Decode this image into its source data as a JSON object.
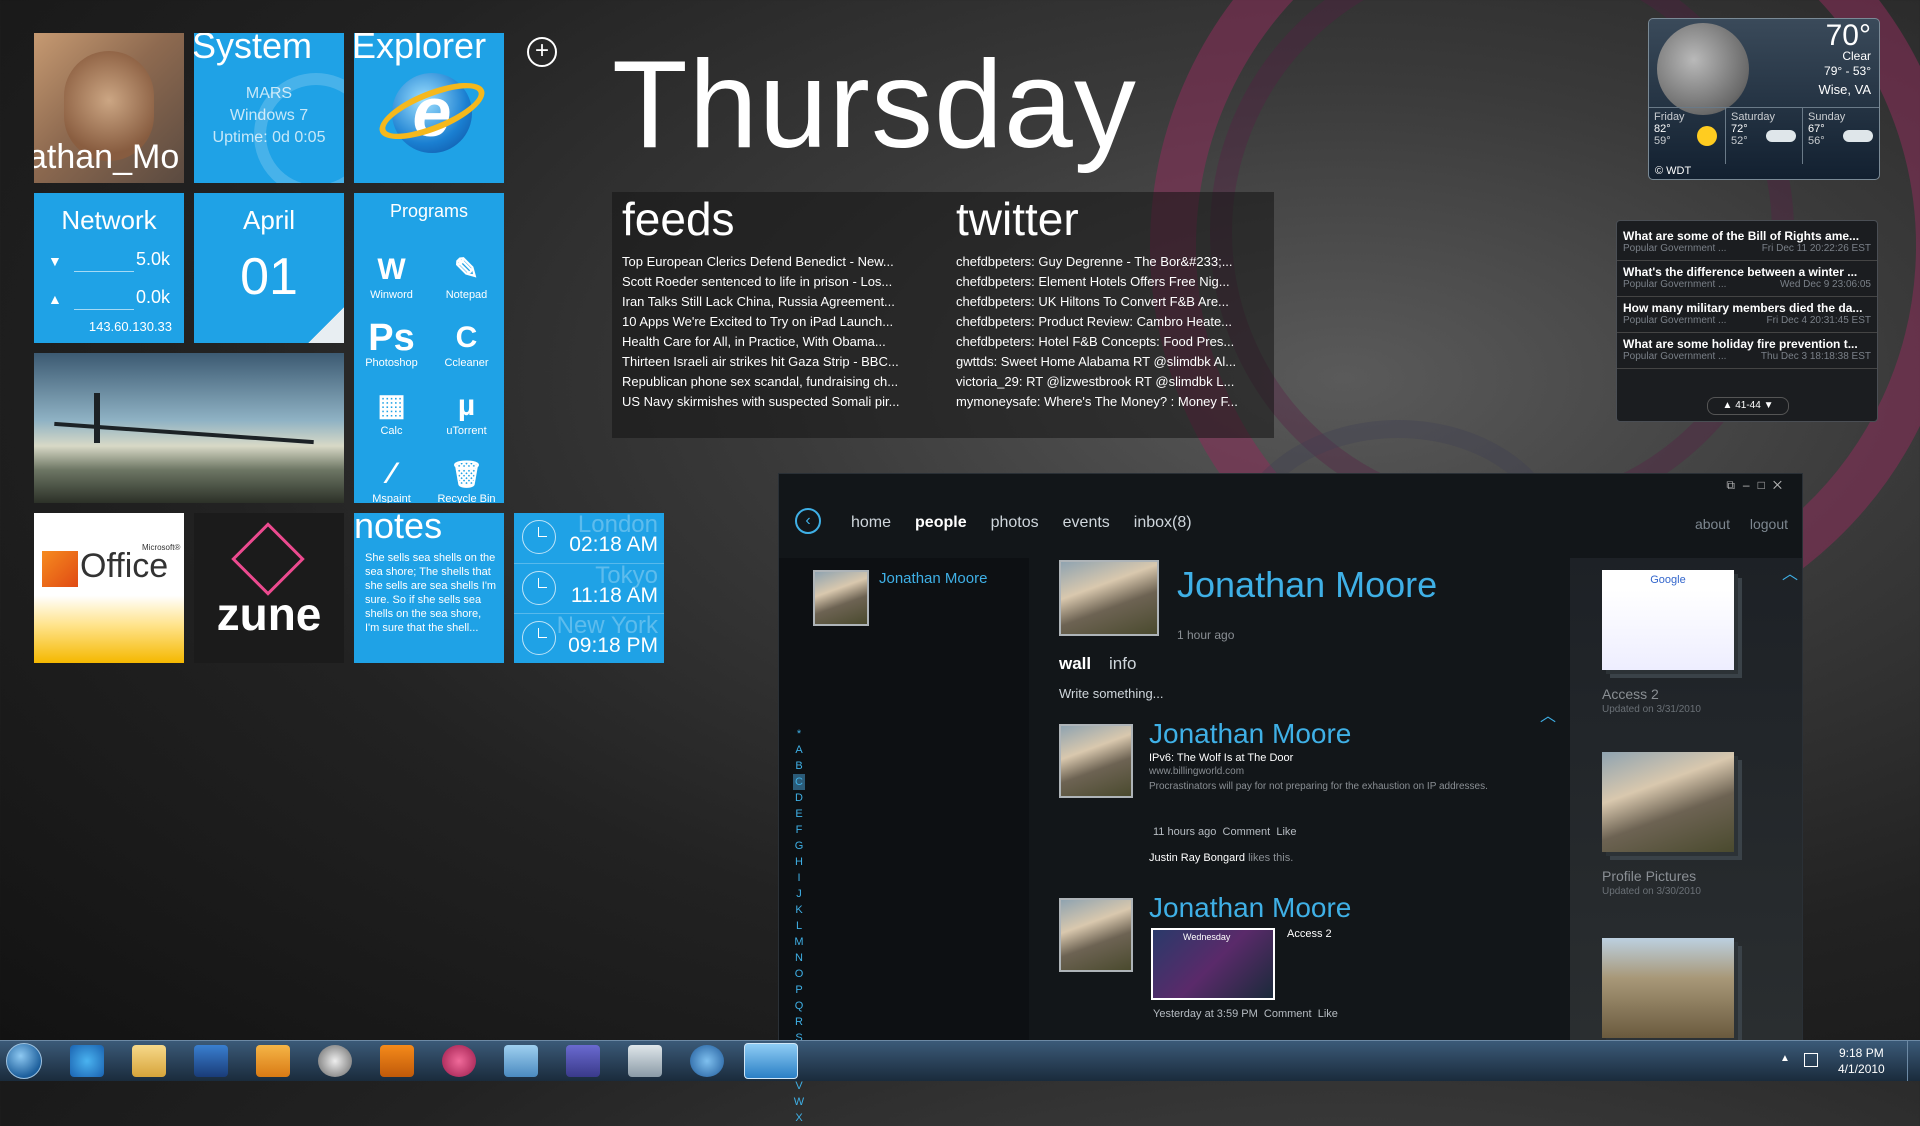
{
  "tiles": {
    "user": {
      "name": "athan_Mo"
    },
    "system": {
      "title": "System",
      "host": "MARS",
      "os": "Windows 7",
      "uptime": "Uptime: 0d 0:05"
    },
    "explorer": {
      "title": "Explorer"
    },
    "add_label": "+",
    "network": {
      "title": "Network",
      "down": "5.0k",
      "up": "0.0k",
      "ip": "143.60.130.33"
    },
    "date": {
      "month": "April",
      "day": "01"
    },
    "programs": {
      "title": "Programs",
      "items": [
        {
          "label": "Winword",
          "glyph": "W"
        },
        {
          "label": "Notepad",
          "glyph": "✎"
        },
        {
          "label": "Photoshop",
          "glyph": "Ps"
        },
        {
          "label": "Ccleaner",
          "glyph": "C"
        },
        {
          "label": "Calc",
          "glyph": "▦"
        },
        {
          "label": "uTorrent",
          "glyph": "µ"
        },
        {
          "label": "Mspaint",
          "glyph": "⁄"
        },
        {
          "label": "Recycle Bin",
          "glyph": "🗑"
        }
      ]
    },
    "office": {
      "brand": "Office",
      "ms": "Microsoft®"
    },
    "zune": {
      "brand": "zune"
    },
    "notes": {
      "title": "notes",
      "body": "She sells sea shells on the sea shore; The shells that she sells are sea shells I'm sure. So if she sells sea shells on the sea shore, I'm sure that the shell..."
    },
    "clocks": [
      {
        "city": "London",
        "time": "02:18 AM"
      },
      {
        "city": "Tokyo",
        "time": "11:18 AM"
      },
      {
        "city": "New York",
        "time": "09:18 PM"
      }
    ]
  },
  "day": "Thursday",
  "feeds": {
    "title": "feeds",
    "items": [
      "Top European Clerics Defend Benedict - New...",
      "Scott Roeder sentenced to life in prison - Los...",
      "Iran Talks Still Lack China, Russia Agreement...",
      "10 Apps We're Excited to Try on iPad Launch...",
      "Health Care for All, in Practice, With Obama...",
      "Thirteen Israeli air strikes hit Gaza Strip - BBC...",
      "Republican phone sex scandal, fundraising ch...",
      "US Navy skirmishes with suspected Somali pir..."
    ]
  },
  "twitter": {
    "title": "twitter",
    "items": [
      "chefdbpeters: Guy Degrenne - The Bor&#233;...",
      "chefdbpeters: Element Hotels Offers Free Nig...",
      "chefdbpeters: UK Hiltons To Convert F&B Are...",
      "chefdbpeters: Product Review: Cambro Heate...",
      "chefdbpeters: Hotel F&B Concepts: Food Pres...",
      "gwttds: Sweet Home Alabama RT @slimdbk Al...",
      "victoria_29: RT @lizwestbrook RT @slimdbk L...",
      "mymoneysafe: Where's The Money? : Money F..."
    ]
  },
  "weather": {
    "temp": "70°",
    "cond": "Clear",
    "range": "79° - 53°",
    "location": "Wise, VA",
    "days": [
      {
        "name": "Friday",
        "hi": "82°",
        "lo": "59°"
      },
      {
        "name": "Saturday",
        "hi": "72°",
        "lo": "52°"
      },
      {
        "name": "Sunday",
        "hi": "67°",
        "lo": "56°"
      }
    ],
    "credit": "© WDT"
  },
  "rss": {
    "items": [
      {
        "title": "What are some of the Bill of Rights ame...",
        "source": "Popular Government ...",
        "date": "Fri Dec 11 20:22:26 EST"
      },
      {
        "title": "What's the difference between a winter ...",
        "source": "Popular Government ...",
        "date": "Wed Dec 9 23:06:05"
      },
      {
        "title": "How many military members died the da...",
        "source": "Popular Government ...",
        "date": "Fri Dec 4 20:31:45 EST"
      },
      {
        "title": "What are some holiday fire prevention t...",
        "source": "Popular Government ...",
        "date": "Thu Dec 3 18:18:38 EST"
      }
    ],
    "pager": "41-44"
  },
  "fb": {
    "nav": [
      "home",
      "people",
      "photos",
      "events",
      "inbox(8)"
    ],
    "active_nav": "people",
    "about": "about",
    "logout": "logout",
    "friend": "Jonathan Moore",
    "letters": [
      "*",
      "A",
      "B",
      "C",
      "D",
      "E",
      "F",
      "G",
      "H",
      "I",
      "J",
      "K",
      "L",
      "M",
      "N",
      "O",
      "P",
      "Q",
      "R",
      "S",
      "T",
      "U",
      "V",
      "W",
      "X"
    ],
    "profile": {
      "name": "Jonathan Moore",
      "time": "1 hour ago"
    },
    "tabs": [
      "wall",
      "info"
    ],
    "write": "Write something...",
    "posts": [
      {
        "name": "Jonathan Moore",
        "link_title": "IPv6: The Wolf Is at The Door",
        "link_url": "www.billingworld.com",
        "desc": "Procrastinators will pay for not preparing for the exhaustion on IP addresses.",
        "meta": "11 hours ago",
        "comment": "Comment",
        "like": "Like",
        "liker": "Justin Ray Bongard",
        "likes": "likes this."
      },
      {
        "name": "Jonathan Moore",
        "caption": "Access 2",
        "thumb_label": "Wednesday",
        "meta": "Yesterday at 3:59 PM",
        "comment": "Comment",
        "like": "Like"
      }
    ],
    "albums": [
      {
        "title": "Access 2",
        "updated": "Updated on 3/31/2010"
      },
      {
        "title": "Profile Pictures",
        "updated": "Updated on 3/30/2010"
      },
      {
        "title": "",
        "updated": ""
      }
    ]
  },
  "taskbar": {
    "time": "9:18 PM",
    "date": "4/1/2010"
  }
}
